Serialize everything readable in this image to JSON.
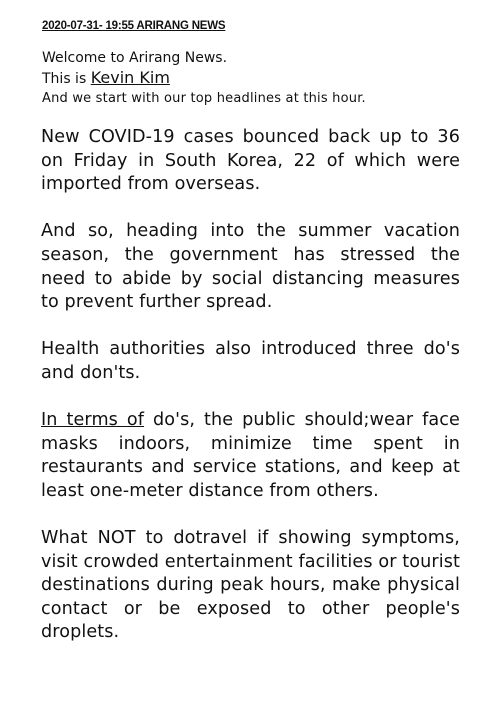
{
  "header": {
    "dateline": "2020-07-31- 19:55 ARIRANG NEWS"
  },
  "intro": {
    "welcome": "Welcome to Arirang News.",
    "this_is": "This is ",
    "anchor_name": "Kevin Kim",
    "start": "And we start with our top headlines at this hour."
  },
  "paragraphs": {
    "p1": "New COVID-19 cases bounced back up to 36 on Friday in South Korea, 22 of which were imported from overseas.",
    "p2": "And so, heading into the summer vacation season, the government has stressed the need to abide by social distancing measures to prevent further spread.",
    "p3": "Health authorities also introduced three do's and don'ts.",
    "p4_underlined": "In terms of",
    "p4_rest": " do's, the public should;wear face masks indoors, minimize time spent in restaurants and service stations, and keep at least one-meter distance from others.",
    "p5": "What NOT to dotravel if showing symptoms, visit crowded entertainment facilities or tourist destinations during peak hours, make physical contact or be exposed to other people's droplets."
  }
}
